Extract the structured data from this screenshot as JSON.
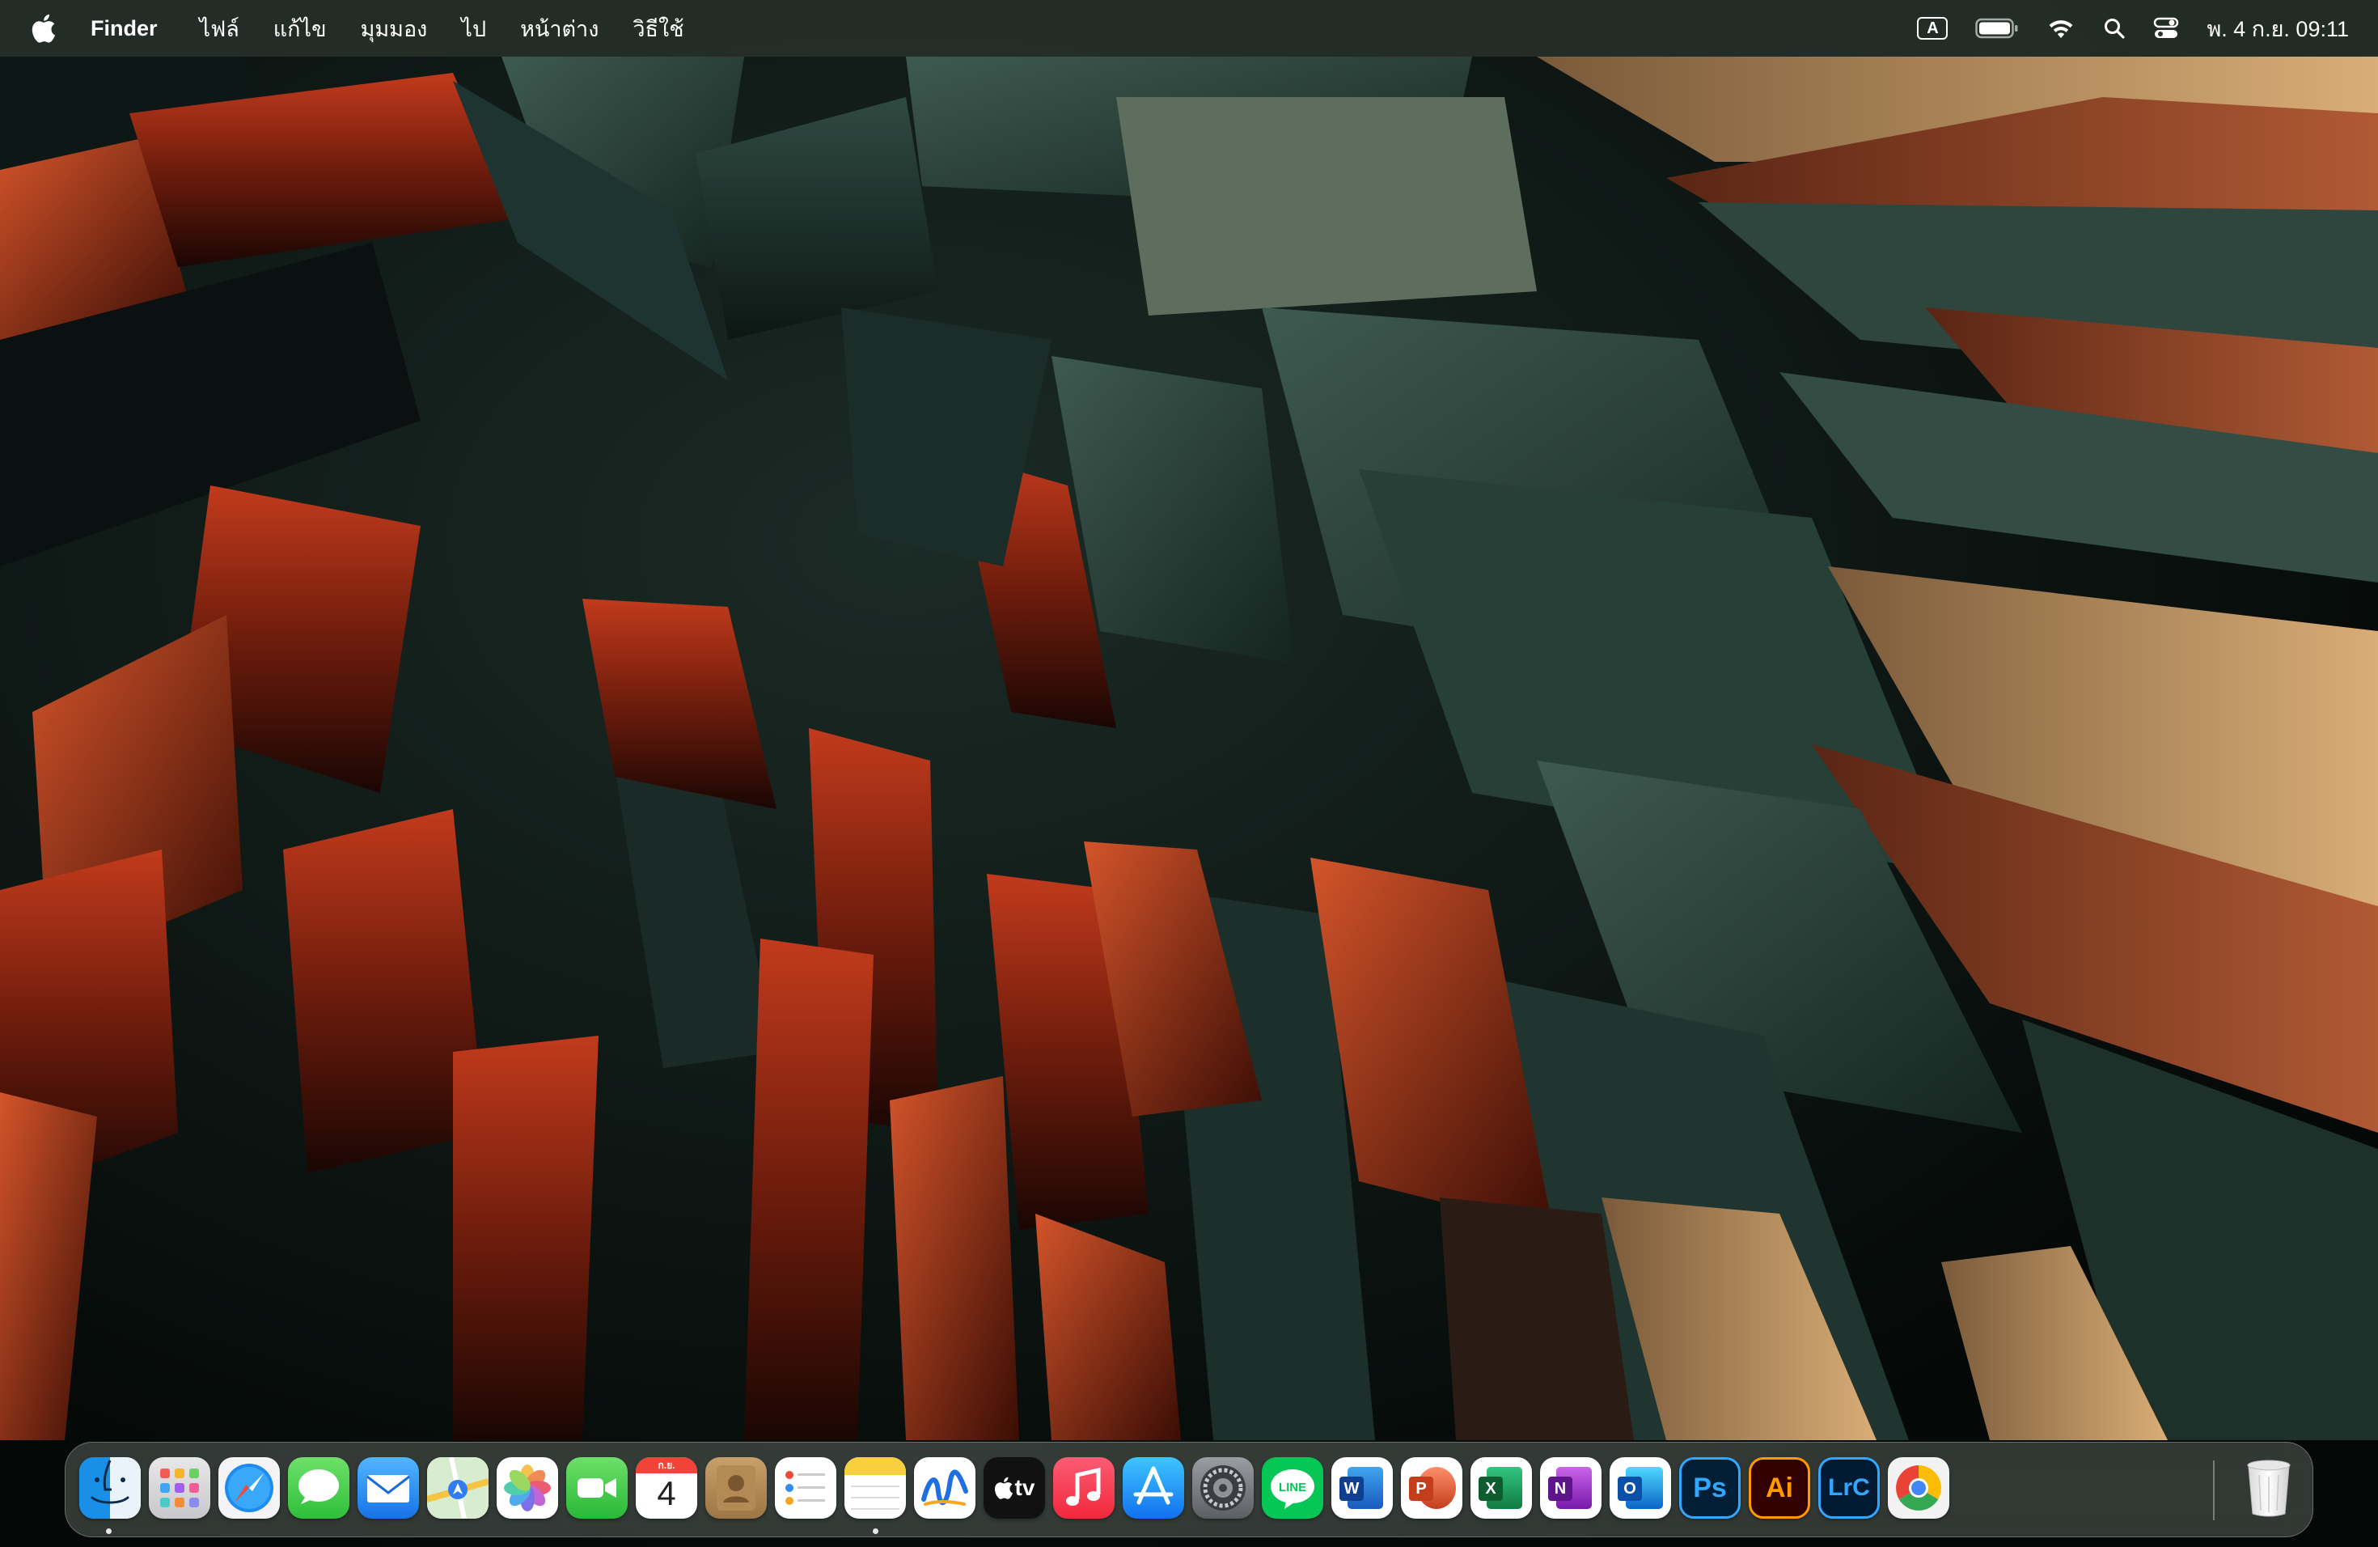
{
  "menubar": {
    "app_name": "Finder",
    "menus": [
      "ไฟล์",
      "แก้ไข",
      "มุมมอง",
      "ไป",
      "หน้าต่าง",
      "วิธีใช้"
    ],
    "input_source": "A",
    "datetime": "พ. 4 ก.ย.  09:11"
  },
  "dock": {
    "items": [
      {
        "name": "Finder",
        "icon": "finder-icon",
        "running": true
      },
      {
        "name": "Launchpad",
        "icon": "launchpad-icon",
        "running": false
      },
      {
        "name": "Safari",
        "icon": "safari-icon",
        "running": false
      },
      {
        "name": "Messages",
        "icon": "messages-icon",
        "running": false
      },
      {
        "name": "Mail",
        "icon": "mail-icon",
        "running": false
      },
      {
        "name": "Maps",
        "icon": "maps-icon",
        "running": false
      },
      {
        "name": "Photos",
        "icon": "photos-icon",
        "running": false
      },
      {
        "name": "FaceTime",
        "icon": "facetime-icon",
        "running": false
      },
      {
        "name": "Calendar",
        "icon": "calendar-icon",
        "running": false,
        "month": "ก.ย.",
        "day": "4"
      },
      {
        "name": "Contacts",
        "icon": "contacts-icon",
        "running": false
      },
      {
        "name": "Reminders",
        "icon": "reminders-icon",
        "running": false
      },
      {
        "name": "Notes",
        "icon": "notes-icon",
        "running": true
      },
      {
        "name": "Freeform",
        "icon": "freeform-icon",
        "running": false
      },
      {
        "name": "TV",
        "icon": "apple-tv-icon",
        "running": false,
        "label": "tv"
      },
      {
        "name": "Music",
        "icon": "music-icon",
        "running": false
      },
      {
        "name": "App Store",
        "icon": "app-store-icon",
        "running": false
      },
      {
        "name": "System Settings",
        "icon": "system-settings-icon",
        "running": false
      },
      {
        "name": "LINE",
        "icon": "line-icon",
        "running": false,
        "label": "LINE"
      },
      {
        "name": "Microsoft Word",
        "icon": "word-icon",
        "running": false,
        "label": "W"
      },
      {
        "name": "Microsoft PowerPoint",
        "icon": "powerpoint-icon",
        "running": false,
        "label": "P"
      },
      {
        "name": "Microsoft Excel",
        "icon": "excel-icon",
        "running": false,
        "label": "X"
      },
      {
        "name": "Microsoft OneNote",
        "icon": "onenote-icon",
        "running": false,
        "label": "N"
      },
      {
        "name": "Microsoft Outlook",
        "icon": "outlook-icon",
        "running": false,
        "label": "O"
      },
      {
        "name": "Adobe Photoshop",
        "icon": "photoshop-icon",
        "running": false,
        "label": "Ps"
      },
      {
        "name": "Adobe Illustrator",
        "icon": "illustrator-icon",
        "running": false,
        "label": "Ai"
      },
      {
        "name": "Lightroom Classic",
        "icon": "lightroom-classic-icon",
        "running": false,
        "label": "LrC"
      },
      {
        "name": "Google Chrome",
        "icon": "chrome-icon",
        "running": false
      }
    ],
    "trash": {
      "name": "Trash",
      "icon": "trash-icon"
    }
  }
}
